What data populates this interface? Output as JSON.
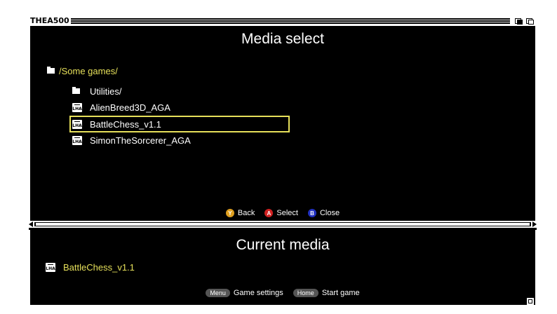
{
  "screen": {
    "title": "THEA500",
    "heading": "Media select",
    "current_heading": "Current media"
  },
  "browser": {
    "path": "/Some games/",
    "items": [
      {
        "label": "Utilities/",
        "icon": "folder-icon"
      },
      {
        "label": "AlienBreed3D_AGA",
        "icon": "lha-archive-icon"
      },
      {
        "label": "BattleChess_v1.1",
        "icon": "lha-archive-icon",
        "selected": true
      },
      {
        "label": "SimonTheSorcerer_AGA",
        "icon": "lha-archive-icon"
      }
    ],
    "icon_text": "LHA"
  },
  "hints": {
    "back_key": "Y",
    "back_label": "Back",
    "select_key": "A",
    "select_label": "Select",
    "close_key": "B",
    "close_label": "Close"
  },
  "current": {
    "label": "BattleChess_v1.1"
  },
  "bottom_hints": {
    "menu_key": "Menu",
    "menu_label": "Game settings",
    "home_key": "Home",
    "home_label": "Start game"
  },
  "colors": {
    "highlight": "#e6e05a",
    "button_y": "#e0a020",
    "button_a": "#d02020",
    "button_b": "#2030c0"
  }
}
